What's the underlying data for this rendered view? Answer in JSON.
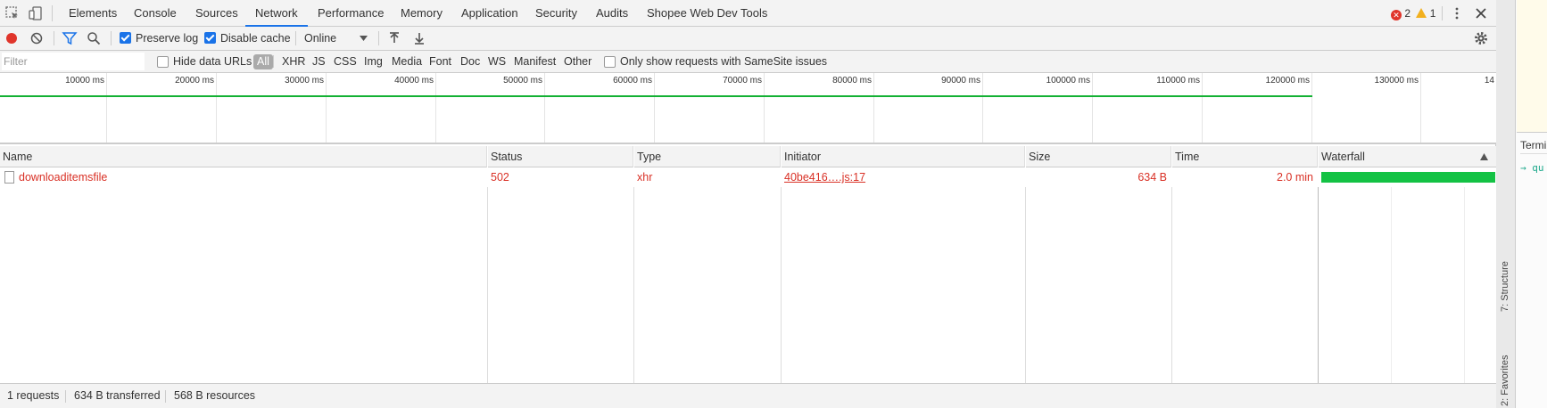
{
  "tabbar": {
    "tabs": [
      "Elements",
      "Console",
      "Sources",
      "Network",
      "Performance",
      "Memory",
      "Application",
      "Security",
      "Audits",
      "Shopee Web Dev Tools"
    ],
    "active_tab": "Network",
    "error_count": "2",
    "warning_count": "1"
  },
  "toolbar": {
    "preserve_log_label": "Preserve log",
    "disable_cache_label": "Disable cache",
    "throttle_value": "Online"
  },
  "filterbar": {
    "placeholder": "Filter",
    "hide_data_urls_label": "Hide data URLs",
    "types": [
      "All",
      "XHR",
      "JS",
      "CSS",
      "Img",
      "Media",
      "Font",
      "Doc",
      "WS",
      "Manifest",
      "Other"
    ],
    "samesite_label": "Only show requests with SameSite issues"
  },
  "overview": {
    "ticks": [
      "10000 ms",
      "20000 ms",
      "30000 ms",
      "40000 ms",
      "50000 ms",
      "60000 ms",
      "70000 ms",
      "80000 ms",
      "90000 ms",
      "100000 ms",
      "110000 ms",
      "120000 ms",
      "130000 ms",
      "14"
    ]
  },
  "table": {
    "headers": [
      "Name",
      "Status",
      "Type",
      "Initiator",
      "Size",
      "Time",
      "Waterfall"
    ],
    "rows": [
      {
        "name": "downloaditemsfile",
        "status": "502",
        "type": "xhr",
        "initiator": "40be416….js:17",
        "size": "634 B",
        "time": "2.0 min"
      }
    ]
  },
  "statusbar": {
    "requests": "1 requests",
    "transferred": "634 B transferred",
    "resources": "568 B resources"
  },
  "side": {
    "terminal_label": "Termi",
    "terminal_prompt": "→  qu",
    "structure_label": "7: Structure",
    "favorites_label": "2: Favorites"
  },
  "colors": {
    "accent": "#1a73e8",
    "error": "#d93025",
    "record": "#e0352b",
    "waterfall": "#13c244"
  }
}
